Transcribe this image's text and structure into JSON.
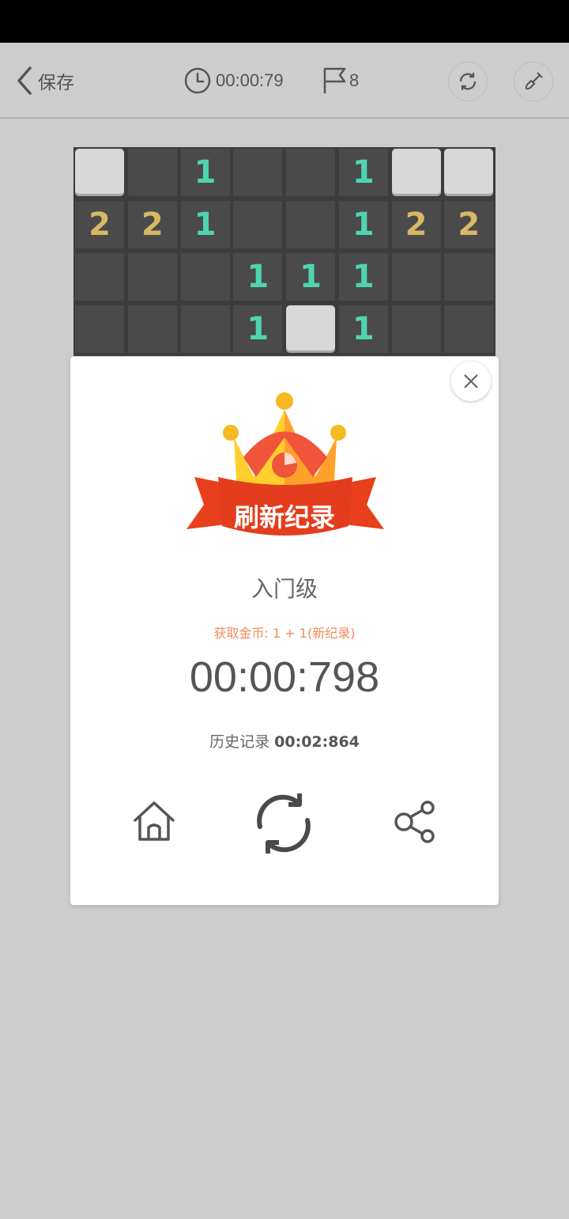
{
  "top_bar": {
    "back_label": "保存",
    "timer": "00:00:79",
    "flag_count": "8"
  },
  "board": {
    "rows": [
      [
        "h",
        "",
        "1",
        "",
        "",
        "1",
        "h",
        "h"
      ],
      [
        "2",
        "2",
        "1",
        "",
        "",
        "1",
        "2",
        "2"
      ],
      [
        "",
        "",
        "",
        "1",
        "1",
        "1",
        "",
        ""
      ],
      [
        "",
        "",
        "",
        "1",
        "h",
        "1",
        "",
        ""
      ]
    ],
    "first_hidden": true
  },
  "modal": {
    "banner": "刷新纪录",
    "level": "入门级",
    "reward": "获取金币: 1 + 1(新纪录)",
    "time": "00:00:798",
    "history_label": "历史记录",
    "history_value": "00:02:864"
  },
  "icons": {
    "back": "chevron-left-icon",
    "timer": "clock-icon",
    "flag": "flag-icon",
    "restart": "refresh-icon",
    "shovel": "shovel-icon",
    "close": "close-icon",
    "home": "home-icon",
    "replay": "refresh-icon",
    "share": "share-icon"
  },
  "colors": {
    "number_1": "#4fd4b0",
    "number_2": "#d8b766",
    "reward_text": "#f08a5d",
    "banner_red": "#e8401c"
  }
}
